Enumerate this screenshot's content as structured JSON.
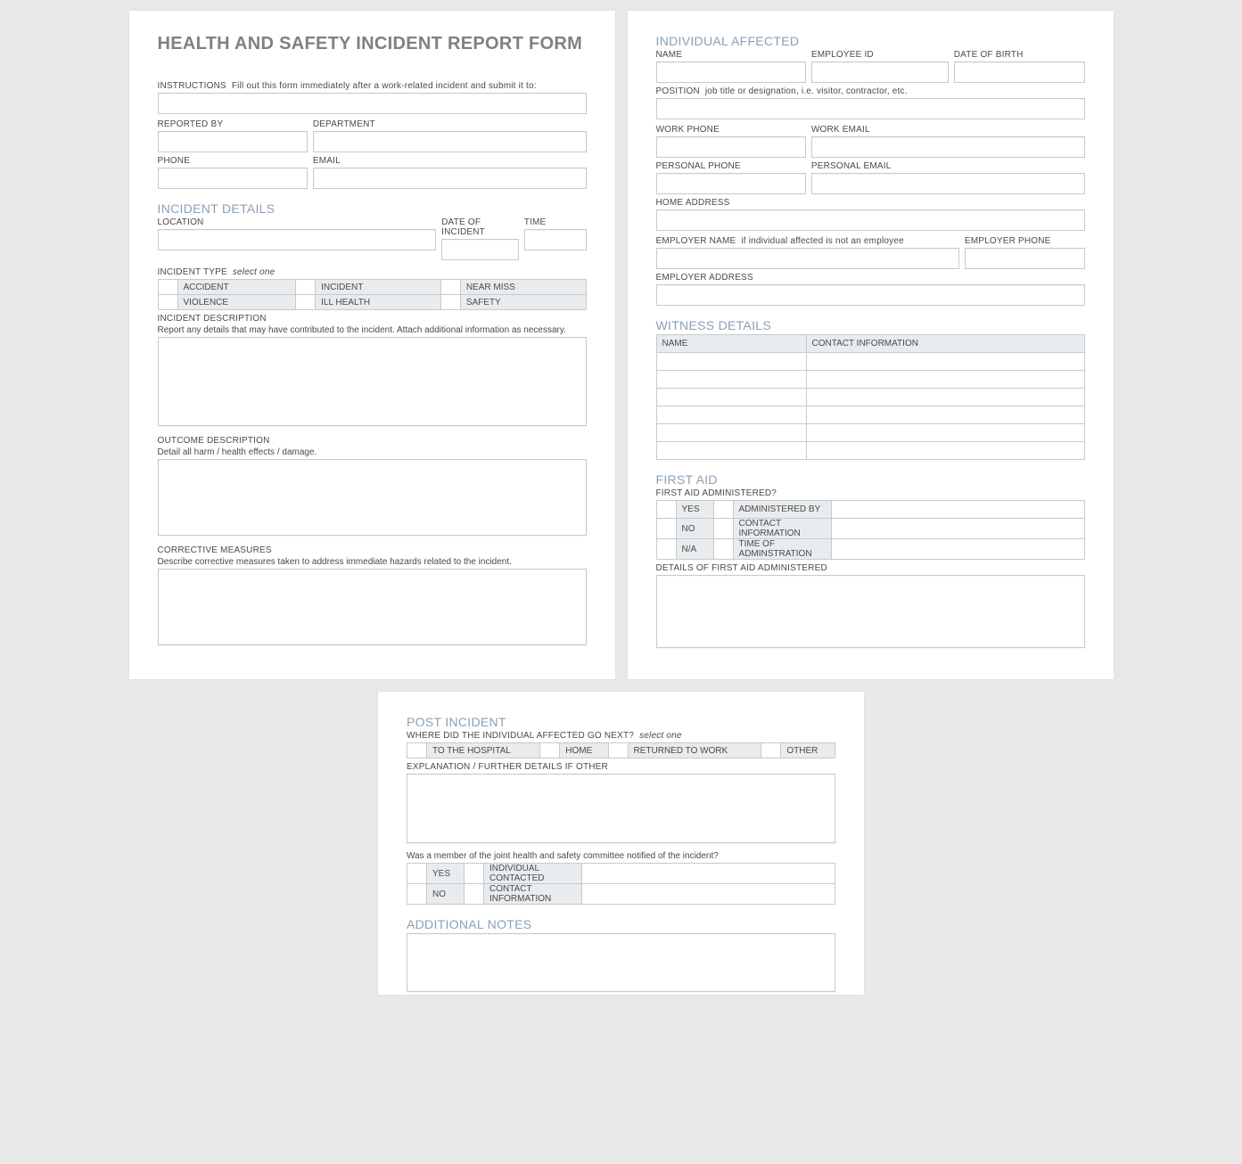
{
  "title": "HEALTH AND SAFETY INCIDENT REPORT FORM",
  "instructions": {
    "label": "INSTRUCTIONS",
    "text": "Fill out this form immediately after a work-related incident and submit it to:"
  },
  "reporter": {
    "reported_by": "REPORTED BY",
    "department": "DEPARTMENT",
    "phone": "PHONE",
    "email": "EMAIL"
  },
  "incident_details": {
    "heading": "INCIDENT DETAILS",
    "location": "LOCATION",
    "date": "DATE OF INCIDENT",
    "time": "TIME",
    "type_label": "INCIDENT TYPE",
    "type_hint": "select one",
    "types": [
      "ACCIDENT",
      "INCIDENT",
      "NEAR MISS",
      "VIOLENCE",
      "ILL HEALTH",
      "SAFETY"
    ],
    "desc_label": "INCIDENT DESCRIPTION",
    "desc_sub": "Report any details that may have contributed to the incident.  Attach additional information as necessary.",
    "outcome_label": "OUTCOME DESCRIPTION",
    "outcome_sub": "Detail all harm / health effects / damage.",
    "corrective_label": "CORRECTIVE MEASURES",
    "corrective_sub": "Describe corrective measures taken to address immediate hazards related to the incident."
  },
  "individual": {
    "heading": "INDIVIDUAL AFFECTED",
    "name": "NAME",
    "employee_id": "EMPLOYEE ID",
    "dob": "DATE OF BIRTH",
    "position_label": "POSITION",
    "position_hint": "job title or designation, i.e. visitor, contractor, etc.",
    "work_phone": "WORK PHONE",
    "work_email": "WORK EMAIL",
    "personal_phone": "PERSONAL PHONE",
    "personal_email": "PERSONAL EMAIL",
    "home_address": "HOME ADDRESS",
    "employer_name_label": "EMPLOYER NAME",
    "employer_name_hint": "if individual affected is not an employee",
    "employer_phone": "EMPLOYER PHONE",
    "employer_address": "EMPLOYER ADDRESS"
  },
  "witness": {
    "heading": "WITNESS DETAILS",
    "col_name": "NAME",
    "col_contact": "CONTACT INFORMATION",
    "rows": 6
  },
  "first_aid": {
    "heading": "FIRST AID",
    "question": "FIRST AID ADMINISTERED?",
    "yes": "YES",
    "no": "NO",
    "na": "N/A",
    "admin_by": "ADMINISTERED BY",
    "contact": "CONTACT INFORMATION",
    "time": "TIME OF ADMINSTRATION",
    "details_label": "DETAILS OF FIRST AID ADMINISTERED"
  },
  "post": {
    "heading": "POST INCIDENT",
    "where_label": "WHERE DID THE INDIVIDUAL AFFECTED GO NEXT?",
    "where_hint": "select one",
    "where_options": [
      "TO THE HOSPITAL",
      "HOME",
      "RETURNED TO WORK",
      "OTHER"
    ],
    "explain_label": "EXPLANATION / FURTHER DETAILS IF OTHER",
    "committee_q": "Was a member of the joint health and safety committee notified of the incident?",
    "yes": "YES",
    "no": "NO",
    "individual_contacted": "INDIVIDUAL CONTACTED",
    "contact_info": "CONTACT INFORMATION"
  },
  "notes": {
    "heading": "ADDITIONAL NOTES"
  }
}
